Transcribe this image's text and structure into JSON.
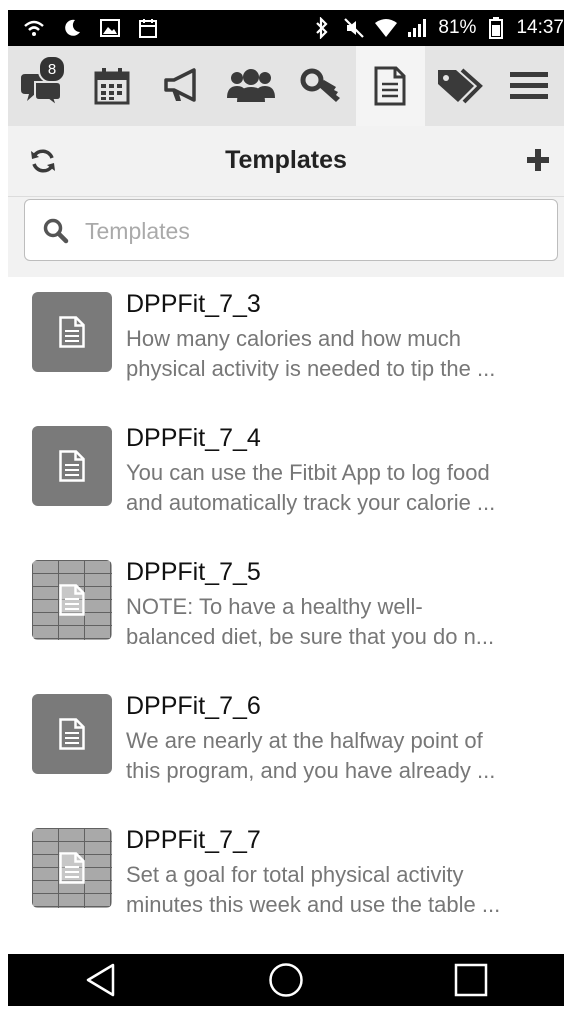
{
  "status_bar": {
    "battery": "81%",
    "time": "14:37"
  },
  "toolbar": {
    "chat_badge_count": "8",
    "buttons": [
      "chat-icon",
      "calendar-icon",
      "megaphone-icon",
      "group-icon",
      "key-icon",
      "document-icon",
      "tag-icon",
      "menu-icon"
    ],
    "active": "document-icon"
  },
  "header": {
    "title": "Templates"
  },
  "search": {
    "placeholder": "Templates"
  },
  "templates": [
    {
      "name": "DPPFit_7_3",
      "line1": "How many calories and how much",
      "line2": "physical activity is needed to tip the ...",
      "thumb": "document-thumbnail"
    },
    {
      "name": "DPPFit_7_4",
      "line1": "You can use the Fitbit App to log food",
      "line2": "and automatically track your calorie ...",
      "thumb": "document-thumbnail"
    },
    {
      "name": "DPPFit_7_5",
      "line1": "NOTE: To have a healthy well-",
      "line2": "balanced diet, be sure that you do n...",
      "thumb": "table-thumbnail"
    },
    {
      "name": "DPPFit_7_6",
      "line1": "We are nearly at the halfway point of",
      "line2": "this program, and you have already ...",
      "thumb": "document-thumbnail"
    },
    {
      "name": "DPPFit_7_7",
      "line1": "Set a goal for total physical activity",
      "line2": "minutes this week and use the table ...",
      "thumb": "table-thumbnail"
    }
  ],
  "colors": {
    "status_bar": "#000000",
    "toolbar": "#e4e4e4",
    "header": "#f2f2f2",
    "thumbnail": "#7a7a7a",
    "title_text": "#222222",
    "desc_text": "#777777"
  }
}
